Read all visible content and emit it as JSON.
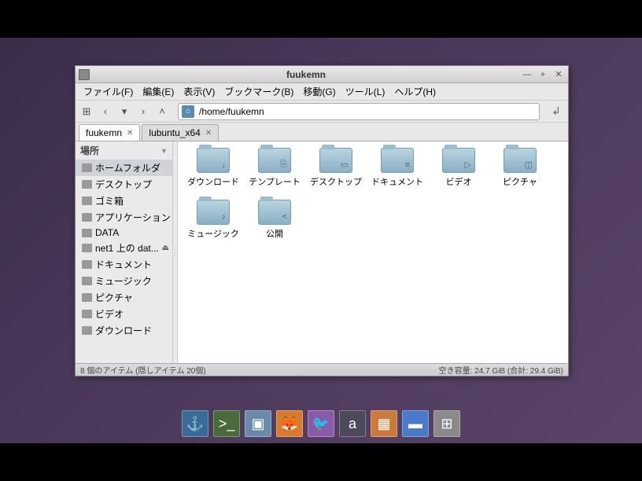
{
  "window": {
    "title": "fuukemn",
    "path": "/home/fuukemn"
  },
  "menubar": {
    "file": "ファイル(F)",
    "edit": "編集(E)",
    "view": "表示(V)",
    "bookmarks": "ブックマーク(B)",
    "go": "移動(G)",
    "tools": "ツール(L)",
    "help": "ヘルプ(H)"
  },
  "tabs": [
    {
      "label": "fuukemn",
      "active": true
    },
    {
      "label": "lubuntu_x64",
      "active": false
    }
  ],
  "sidebar": {
    "header": "場所",
    "items": [
      {
        "label": "ホームフォルダ",
        "selected": true,
        "eject": false
      },
      {
        "label": "デスクトップ",
        "selected": false,
        "eject": false
      },
      {
        "label": "ゴミ箱",
        "selected": false,
        "eject": false
      },
      {
        "label": "アプリケーション",
        "selected": false,
        "eject": false
      },
      {
        "label": "DATA",
        "selected": false,
        "eject": false
      },
      {
        "label": "net1 上の dat...",
        "selected": false,
        "eject": true
      },
      {
        "label": "ドキュメント",
        "selected": false,
        "eject": false
      },
      {
        "label": "ミュージック",
        "selected": false,
        "eject": false
      },
      {
        "label": "ピクチャ",
        "selected": false,
        "eject": false
      },
      {
        "label": "ビデオ",
        "selected": false,
        "eject": false
      },
      {
        "label": "ダウンロード",
        "selected": false,
        "eject": false
      }
    ]
  },
  "folders": [
    {
      "label": "ダウンロード",
      "glyph": "↓"
    },
    {
      "label": "テンプレート",
      "glyph": "⎘"
    },
    {
      "label": "デスクトップ",
      "glyph": "▭"
    },
    {
      "label": "ドキュメント",
      "glyph": "≡"
    },
    {
      "label": "ビデオ",
      "glyph": "▷"
    },
    {
      "label": "ピクチャ",
      "glyph": "◫"
    },
    {
      "label": "ミュージック",
      "glyph": "♪"
    },
    {
      "label": "公開",
      "glyph": "<"
    }
  ],
  "statusbar": {
    "left": "8 個のアイテム (隠しアイテム 20個)",
    "right": "空き容量: 24.7 GiB (合計: 29.4 GiB)"
  },
  "taskbar": [
    {
      "name": "anchor",
      "glyph": "⚓",
      "bg": "#3a6a9a"
    },
    {
      "name": "terminal",
      "glyph": ">_",
      "bg": "#4a6a3a"
    },
    {
      "name": "files",
      "glyph": "▣",
      "bg": "#6a8aaa"
    },
    {
      "name": "firefox",
      "glyph": "🦊",
      "bg": "#da7a2a"
    },
    {
      "name": "pidgin",
      "glyph": "🐦",
      "bg": "#8a5aaa"
    },
    {
      "name": "abiword",
      "glyph": "a",
      "bg": "#4a4a5a"
    },
    {
      "name": "gnumeric",
      "glyph": "▦",
      "bg": "#ca7a3a"
    },
    {
      "name": "xterm",
      "glyph": "▬",
      "bg": "#4a7aca"
    },
    {
      "name": "calculator",
      "glyph": "⊞",
      "bg": "#8a8a8a"
    }
  ]
}
